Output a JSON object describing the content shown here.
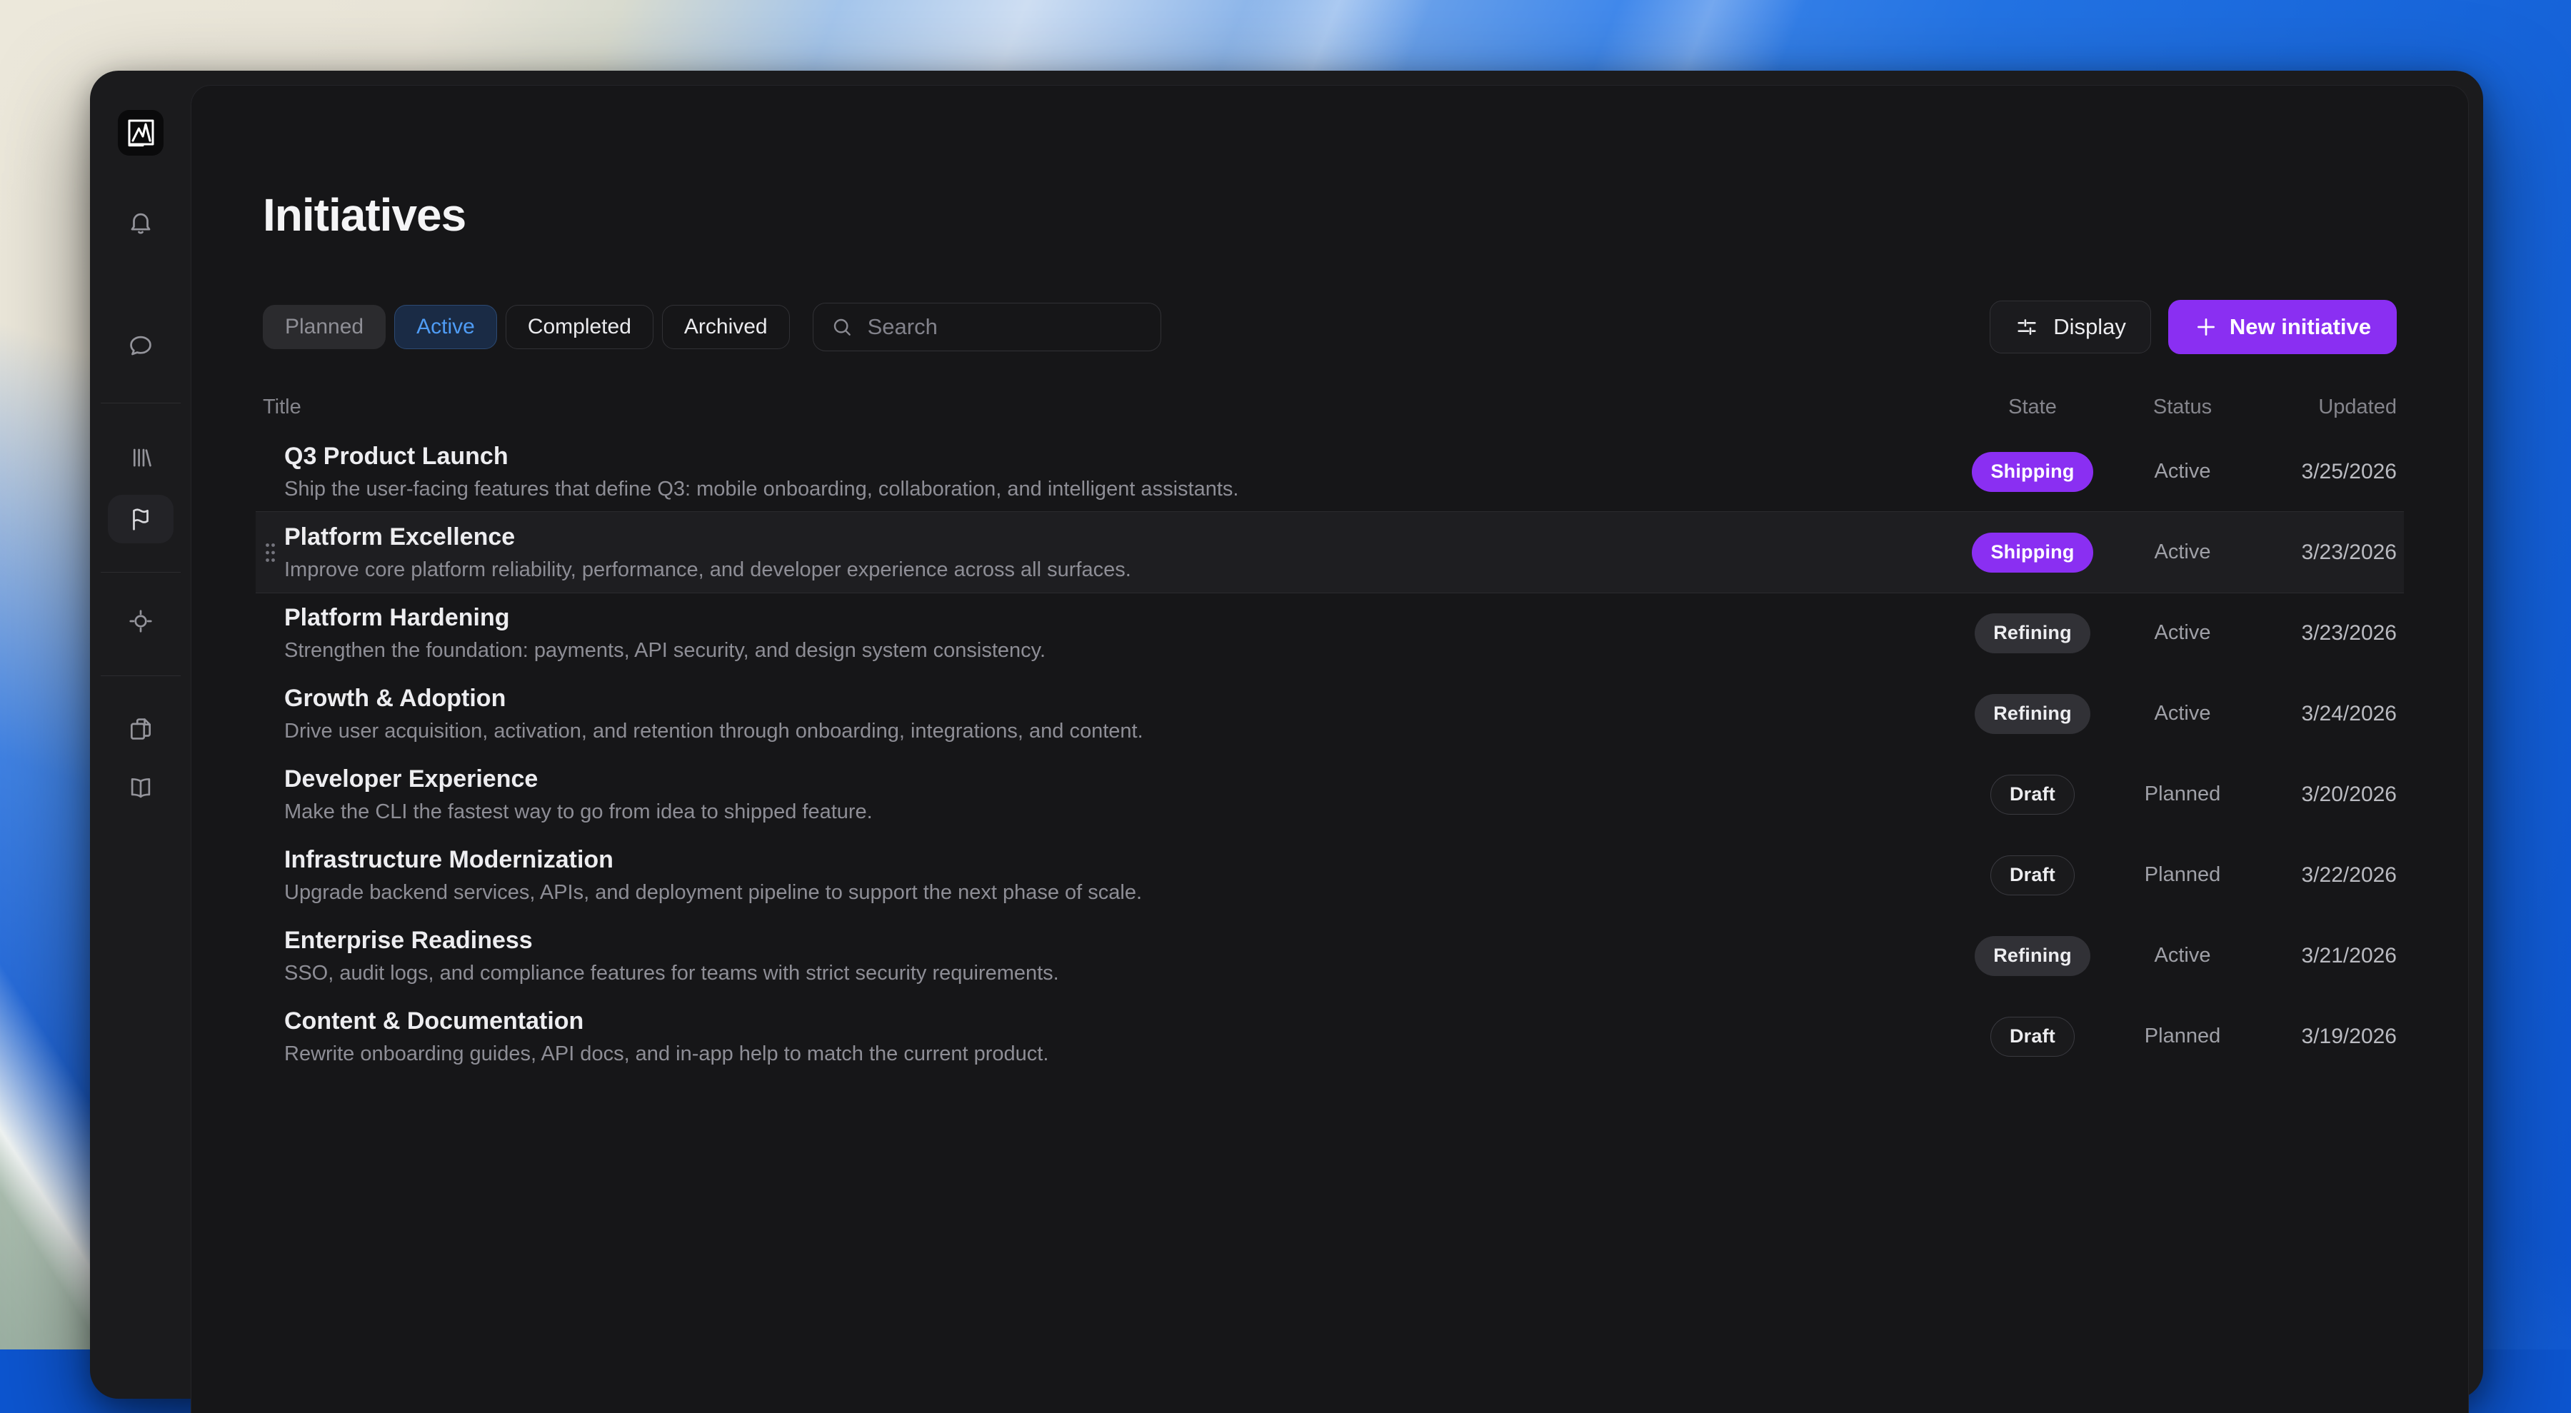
{
  "page": {
    "title": "Initiatives"
  },
  "sidebar": {
    "items": [
      {
        "icon": "app-logo"
      },
      {
        "icon": "bell-icon"
      },
      {
        "icon": "chat-bubble-icon"
      },
      {
        "icon": "library-icon"
      },
      {
        "icon": "flag-icon",
        "active": true
      },
      {
        "icon": "target-icon"
      },
      {
        "icon": "copy-pages-icon"
      },
      {
        "icon": "open-book-icon"
      }
    ]
  },
  "filters": {
    "tabs": [
      {
        "label": "Planned",
        "state": "muted"
      },
      {
        "label": "Active",
        "state": "selected"
      },
      {
        "label": "Completed",
        "state": "default"
      },
      {
        "label": "Archived",
        "state": "default"
      }
    ],
    "search_placeholder": "Search"
  },
  "toolbar": {
    "display_label": "Display",
    "new_initiative_label": "New initiative"
  },
  "table": {
    "columns": [
      "Title",
      "State",
      "Status",
      "Updated"
    ],
    "rows": [
      {
        "title": "Q3 Product Launch",
        "description": "Ship the user-facing features that define Q3: mobile onboarding, collaboration, and intelligent assistants.",
        "state": "Shipping",
        "state_variant": "accent",
        "status": "Active",
        "updated": "3/25/2026",
        "hovered": false
      },
      {
        "title": "Platform Excellence",
        "description": "Improve core platform reliability, performance, and developer experience across all surfaces.",
        "state": "Shipping",
        "state_variant": "accent",
        "status": "Active",
        "updated": "3/23/2026",
        "hovered": true
      },
      {
        "title": "Platform Hardening",
        "description": "Strengthen the foundation: payments, API security, and design system consistency.",
        "state": "Refining",
        "state_variant": "gray",
        "status": "Active",
        "updated": "3/23/2026",
        "hovered": false
      },
      {
        "title": "Growth & Adoption",
        "description": "Drive user acquisition, activation, and retention through onboarding, integrations, and content.",
        "state": "Refining",
        "state_variant": "gray",
        "status": "Active",
        "updated": "3/24/2026",
        "hovered": false
      },
      {
        "title": "Developer Experience",
        "description": "Make the CLI the fastest way to go from idea to shipped feature.",
        "state": "Draft",
        "state_variant": "outline",
        "status": "Planned",
        "updated": "3/20/2026",
        "hovered": false
      },
      {
        "title": "Infrastructure Modernization",
        "description": "Upgrade backend services, APIs, and deployment pipeline to support the next phase of scale.",
        "state": "Draft",
        "state_variant": "outline",
        "status": "Planned",
        "updated": "3/22/2026",
        "hovered": false
      },
      {
        "title": "Enterprise Readiness",
        "description": "SSO, audit logs, and compliance features for teams with strict security requirements.",
        "state": "Refining",
        "state_variant": "gray",
        "status": "Active",
        "updated": "3/21/2026",
        "hovered": false
      },
      {
        "title": "Content & Documentation",
        "description": "Rewrite onboarding guides, API docs, and in-app help to match the current product.",
        "state": "Draft",
        "state_variant": "outline",
        "status": "Planned",
        "updated": "3/19/2026",
        "hovered": false
      }
    ]
  },
  "colors": {
    "accent_purple": "#8a2ff2",
    "selected_tab_blue": "#4f9cf5",
    "panel_background": "#161618"
  }
}
